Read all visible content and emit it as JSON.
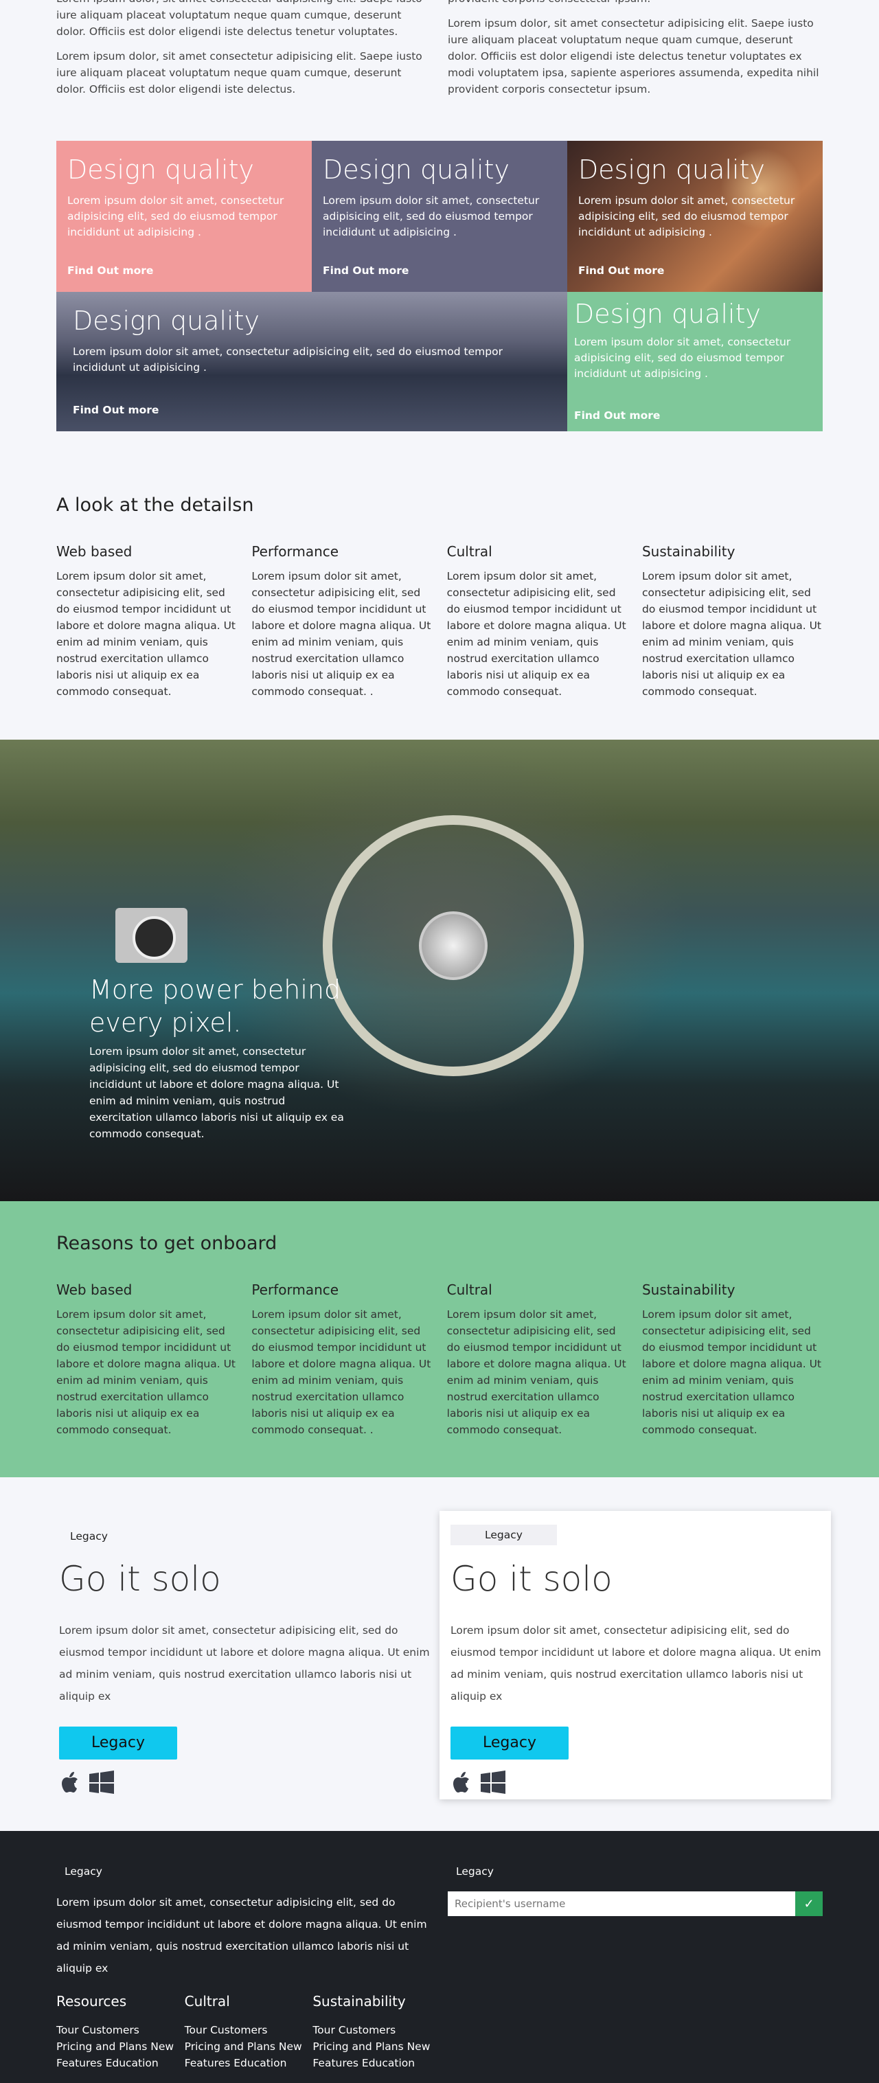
{
  "intro": {
    "left": [
      "Lorem ipsum dolor, sit amet consectetur adipisicing elit. Saepe iusto iure aliquam placeat voluptatum neque quam cumque, deserunt dolor. Officiis est dolor eligendi iste delectus tenetur voluptates.",
      "Lorem ipsum dolor, sit amet consectetur adipisicing elit. Saepe iusto iure aliquam placeat voluptatum neque quam cumque, deserunt dolor. Officiis est dolor eligendi iste delectus."
    ],
    "right": [
      "provident corporis consectetur ipsum.",
      "Lorem ipsum dolor, sit amet consectetur adipisicing elit. Saepe iusto iure aliquam placeat voluptatum neque quam cumque, deserunt dolor. Officiis est dolor eligendi iste delectus tenetur voluptates ex modi voluptatem ipsa, sapiente asperiores assumenda, expedita nihil provident corporis consectetur ipsum."
    ]
  },
  "tiles": [
    {
      "title": "Design quality",
      "text": "Lorem ipsum dolor sit amet, consectetur adipisicing elit, sed do eiusmod tempor incididunt ut adipisicing .",
      "link": "Find Out more",
      "color": "#f29b9b"
    },
    {
      "title": "Design quality",
      "text": "Lorem ipsum dolor sit amet, consectetur adipisicing elit, sed do eiusmod tempor incididunt ut adipisicing .",
      "link": "Find Out more",
      "color": "#62627e"
    },
    {
      "title": "Design quality",
      "text": "Lorem ipsum dolor sit amet, consectetur adipisicing elit, sed do eiusmod tempor incididunt ut adipisicing .",
      "link": "Find Out more"
    },
    {
      "title": "Design quality",
      "text": "Lorem ipsum dolor sit amet, consectetur adipisicing elit, sed do eiusmod tempor incididunt ut adipisicing .",
      "link": "Find Out more"
    },
    {
      "title": "Design quality",
      "text": "Lorem ipsum dolor sit amet, consectetur adipisicing elit, sed do eiusmod tempor incididunt ut adipisicing .",
      "link": "Find Out more",
      "color": "#7fc89a"
    }
  ],
  "details": {
    "title": "A look at the detailsn",
    "cols": [
      {
        "heading": "Web based",
        "text": "Lorem ipsum dolor sit amet, consectetur adipisicing elit, sed do eiusmod tempor incididunt ut labore et dolore magna aliqua. Ut enim ad minim veniam, quis nostrud exercitation ullamco laboris nisi ut aliquip ex ea commodo consequat."
      },
      {
        "heading": "Performance",
        "text": "Lorem ipsum dolor sit amet, consectetur adipisicing elit, sed do eiusmod tempor incididunt ut labore et dolore magna aliqua. Ut enim ad minim veniam, quis nostrud exercitation ullamco laboris nisi ut aliquip ex ea commodo consequat. ."
      },
      {
        "heading": "Cultral",
        "text": "Lorem ipsum dolor sit amet, consectetur adipisicing elit, sed do eiusmod tempor incididunt ut labore et dolore magna aliqua. Ut enim ad minim veniam, quis nostrud exercitation ullamco laboris nisi ut aliquip ex ea commodo consequat."
      },
      {
        "heading": "Sustainability",
        "text": "Lorem ipsum dolor sit amet, consectetur adipisicing elit, sed do eiusmod tempor incididunt ut labore et dolore magna aliqua. Ut enim ad minim veniam, quis nostrud exercitation ullamco laboris nisi ut aliquip ex ea commodo consequat."
      }
    ]
  },
  "hero": {
    "title": "More power behind every pixel.",
    "text": "Lorem ipsum dolor sit amet, consectetur adipisicing elit, sed do eiusmod tempor incididunt ut labore et dolore magna aliqua. Ut enim ad minim veniam, quis nostrud exercitation ullamco laboris nisi ut aliquip ex ea commodo consequat."
  },
  "reasons": {
    "title": "Reasons to get onboard",
    "color": "#7fc89a",
    "cols": [
      {
        "heading": "Web based",
        "text": "Lorem ipsum dolor sit amet, consectetur adipisicing elit, sed do eiusmod tempor incididunt ut labore et dolore magna aliqua. Ut enim ad minim veniam, quis nostrud exercitation ullamco laboris nisi ut aliquip ex ea commodo consequat."
      },
      {
        "heading": "Performance",
        "text": "Lorem ipsum dolor sit amet, consectetur adipisicing elit, sed do eiusmod tempor incididunt ut labore et dolore magna aliqua. Ut enim ad minim veniam, quis nostrud exercitation ullamco laboris nisi ut aliquip ex ea commodo consequat. ."
      },
      {
        "heading": "Cultral",
        "text": "Lorem ipsum dolor sit amet, consectetur adipisicing elit, sed do eiusmod tempor incididunt ut labore et dolore magna aliqua. Ut enim ad minim veniam, quis nostrud exercitation ullamco laboris nisi ut aliquip ex ea commodo consequat."
      },
      {
        "heading": "Sustainability",
        "text": "Lorem ipsum dolor sit amet, consectetur adipisicing elit, sed do eiusmod tempor incididunt ut labore et dolore magna aliqua. Ut enim ad minim veniam, quis nostrud exercitation ullamco laboris nisi ut aliquip ex ea commodo consequat."
      }
    ]
  },
  "pricing": [
    {
      "badge": "Legacy",
      "title": "Go it solo",
      "text": "Lorem ipsum dolor sit amet, consectetur adipisicing elit, sed do eiusmod tempor incididunt ut labore et dolore magna aliqua. Ut enim ad minim veniam, quis nostrud exercitation ullamco laboris nisi ut aliquip ex",
      "button": "Legacy",
      "icons": [
        "apple-icon",
        "windows-icon"
      ]
    },
    {
      "badge": "Legacy",
      "title": "Go it solo",
      "text": "Lorem ipsum dolor sit amet, consectetur adipisicing elit, sed do eiusmod tempor incididunt ut labore et dolore magna aliqua. Ut enim ad minim veniam, quis nostrud exercitation ullamco laboris nisi ut aliquip ex",
      "button": "Legacy",
      "icons": [
        "apple-icon",
        "windows-icon"
      ]
    }
  ],
  "accent": "#10c8ee",
  "footer": {
    "left_label": "Legacy",
    "text": "Lorem ipsum dolor sit amet, consectetur adipisicing elit, sed do eiusmod tempor incididunt ut labore et dolore magna aliqua. Ut enim ad minim veniam, quis nostrud exercitation ullamco laboris nisi ut aliquip ex",
    "cols": [
      {
        "heading": "Resources",
        "links": [
          "Tour Customers",
          "Pricing and Plans New",
          "Features Education"
        ]
      },
      {
        "heading": "Cultral",
        "links": [
          "Tour Customers",
          "Pricing and Plans New",
          "Features Education"
        ]
      },
      {
        "heading": "Sustainability",
        "links": [
          "Tour Customers",
          "Pricing and Plans New",
          "Features Education"
        ]
      }
    ],
    "right_label": "Legacy",
    "input_placeholder": "Recipient's username",
    "submit_icon": "check-icon",
    "background": "#1e2126"
  }
}
